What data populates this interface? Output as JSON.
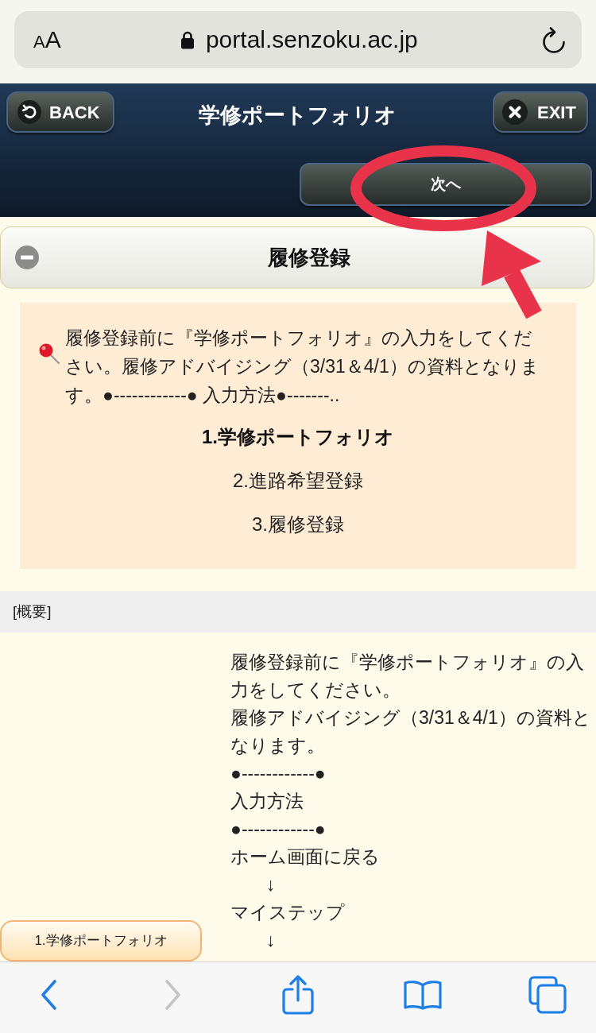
{
  "browser": {
    "text_size_button": "AA",
    "url": "portal.senzoku.ac.jp"
  },
  "header": {
    "back_button": "BACK",
    "title": "学修ポートフォリオ",
    "exit_button": "EXIT",
    "next_button": "次へ"
  },
  "section": {
    "title": "履修登録",
    "expanded": true,
    "notice": {
      "text": "履修登録前に『学修ポートフォリオ』の入力をしてください。履修アドバイジング（3/31＆4/1）の資料となります。●------------● 入力方法●-------..",
      "steps": [
        {
          "label": "1.学修ポートフォリオ",
          "selected": true
        },
        {
          "label": "2.進路希望登録",
          "selected": false
        },
        {
          "label": "3.履修登録",
          "selected": false
        }
      ]
    }
  },
  "overview": {
    "heading": "[概要]",
    "lines": [
      {
        "kind": "text",
        "text": "履修登録前に『学修ポートフォリオ』の入力をしてください。"
      },
      {
        "kind": "text",
        "text": "履修アドバイジング（3/31＆4/1）の資料となります。"
      },
      {
        "kind": "text",
        "text": "●------------●"
      },
      {
        "kind": "text",
        "text": "入力方法"
      },
      {
        "kind": "text",
        "text": "●------------●"
      },
      {
        "kind": "text",
        "text": "ホーム画面に戻る"
      },
      {
        "kind": "arrow",
        "text": "↓"
      },
      {
        "kind": "text",
        "text": "マイステップ"
      },
      {
        "kind": "arrow",
        "text": "↓"
      }
    ]
  },
  "floating_button": "1.学修ポートフォリオ",
  "toolbar": {
    "buttons": [
      {
        "kind": "back",
        "disabled": false
      },
      {
        "kind": "forward",
        "disabled": true
      },
      {
        "kind": "share",
        "disabled": false
      },
      {
        "kind": "bookmarks",
        "disabled": false
      },
      {
        "kind": "tabs",
        "disabled": false
      }
    ]
  }
}
